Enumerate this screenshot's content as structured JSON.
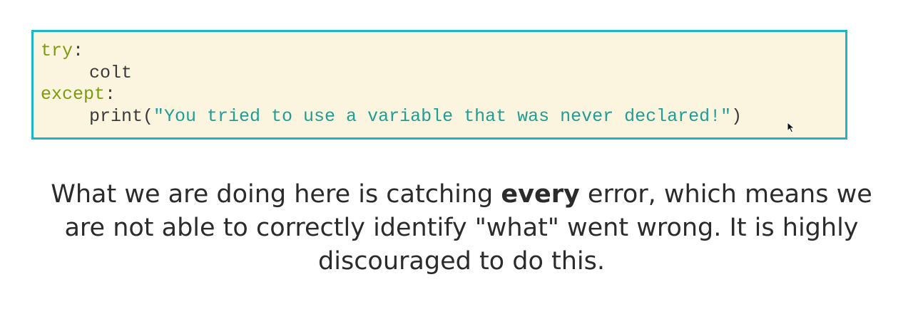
{
  "code": {
    "line1_keyword": "try",
    "line1_colon": ":",
    "line2_text": "colt",
    "line3_keyword": "except",
    "line3_colon": ":",
    "line4_func": "print(",
    "line4_string": "\"You tried to use a variable that was never declared!\"",
    "line4_close": ")"
  },
  "caption": {
    "part1": "What we are doing here is catching ",
    "emphasis": "every",
    "part2": " error, which means we are not able to correctly identify \"what\" went wrong. It is highly discouraged to do this."
  },
  "colors": {
    "border": "#1cb5c9",
    "background": "#fbf5df",
    "keyword": "#7d9b0c",
    "string": "#1f9e96"
  },
  "icons": {
    "cursor": "mouse-pointer-icon"
  }
}
